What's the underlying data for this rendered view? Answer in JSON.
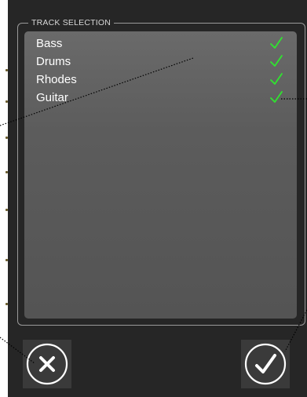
{
  "track_selection": {
    "legend": "TRACK SELECTION",
    "tracks": [
      {
        "label": "Bass",
        "selected": true
      },
      {
        "label": "Drums",
        "selected": true
      },
      {
        "label": "Rhodes",
        "selected": true
      },
      {
        "label": "Guitar",
        "selected": true
      }
    ]
  },
  "actions": {
    "cancel_icon": "close-x-icon",
    "confirm_icon": "checkmark-icon"
  },
  "colors": {
    "panel_bg": "#262626",
    "list_bg": "#5c5c5c",
    "check_green": "#2ee62e",
    "text": "#ffffff"
  }
}
